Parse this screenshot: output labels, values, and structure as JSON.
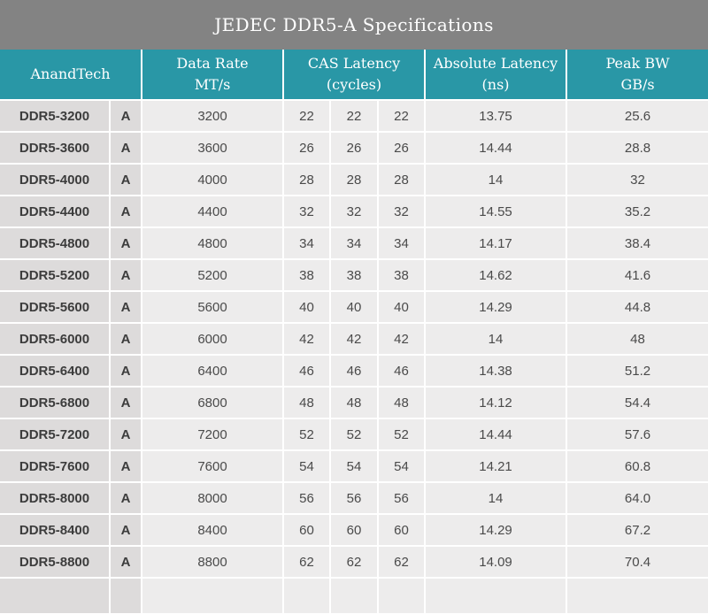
{
  "chart_data": {
    "type": "table",
    "title": "JEDEC DDR5-A Specifications",
    "column_groups": [
      {
        "label": "AnandTech",
        "sublabel": ""
      },
      {
        "label": "Data Rate",
        "sublabel": "MT/s"
      },
      {
        "label": "CAS Latency",
        "sublabel": "(cycles)"
      },
      {
        "label": "Absolute Latency",
        "sublabel": "(ns)"
      },
      {
        "label": "Peak BW",
        "sublabel": "GB/s"
      }
    ],
    "rows": [
      {
        "name": "DDR5-3200",
        "variant": "A",
        "data_rate": "3200",
        "cas": [
          "22",
          "22",
          "22"
        ],
        "absolute_latency": "13.75",
        "peak_bw": "25.6"
      },
      {
        "name": "DDR5-3600",
        "variant": "A",
        "data_rate": "3600",
        "cas": [
          "26",
          "26",
          "26"
        ],
        "absolute_latency": "14.44",
        "peak_bw": "28.8"
      },
      {
        "name": "DDR5-4000",
        "variant": "A",
        "data_rate": "4000",
        "cas": [
          "28",
          "28",
          "28"
        ],
        "absolute_latency": "14",
        "peak_bw": "32"
      },
      {
        "name": "DDR5-4400",
        "variant": "A",
        "data_rate": "4400",
        "cas": [
          "32",
          "32",
          "32"
        ],
        "absolute_latency": "14.55",
        "peak_bw": "35.2"
      },
      {
        "name": "DDR5-4800",
        "variant": "A",
        "data_rate": "4800",
        "cas": [
          "34",
          "34",
          "34"
        ],
        "absolute_latency": "14.17",
        "peak_bw": "38.4"
      },
      {
        "name": "DDR5-5200",
        "variant": "A",
        "data_rate": "5200",
        "cas": [
          "38",
          "38",
          "38"
        ],
        "absolute_latency": "14.62",
        "peak_bw": "41.6"
      },
      {
        "name": "DDR5-5600",
        "variant": "A",
        "data_rate": "5600",
        "cas": [
          "40",
          "40",
          "40"
        ],
        "absolute_latency": "14.29",
        "peak_bw": "44.8"
      },
      {
        "name": "DDR5-6000",
        "variant": "A",
        "data_rate": "6000",
        "cas": [
          "42",
          "42",
          "42"
        ],
        "absolute_latency": "14",
        "peak_bw": "48"
      },
      {
        "name": "DDR5-6400",
        "variant": "A",
        "data_rate": "6400",
        "cas": [
          "46",
          "46",
          "46"
        ],
        "absolute_latency": "14.38",
        "peak_bw": "51.2"
      },
      {
        "name": "DDR5-6800",
        "variant": "A",
        "data_rate": "6800",
        "cas": [
          "48",
          "48",
          "48"
        ],
        "absolute_latency": "14.12",
        "peak_bw": "54.4"
      },
      {
        "name": "DDR5-7200",
        "variant": "A",
        "data_rate": "7200",
        "cas": [
          "52",
          "52",
          "52"
        ],
        "absolute_latency": "14.44",
        "peak_bw": "57.6"
      },
      {
        "name": "DDR5-7600",
        "variant": "A",
        "data_rate": "7600",
        "cas": [
          "54",
          "54",
          "54"
        ],
        "absolute_latency": "14.21",
        "peak_bw": "60.8"
      },
      {
        "name": "DDR5-8000",
        "variant": "A",
        "data_rate": "8000",
        "cas": [
          "56",
          "56",
          "56"
        ],
        "absolute_latency": "14",
        "peak_bw": "64.0"
      },
      {
        "name": "DDR5-8400",
        "variant": "A",
        "data_rate": "8400",
        "cas": [
          "60",
          "60",
          "60"
        ],
        "absolute_latency": "14.29",
        "peak_bw": "67.2"
      },
      {
        "name": "DDR5-8800",
        "variant": "A",
        "data_rate": "8800",
        "cas": [
          "62",
          "62",
          "62"
        ],
        "absolute_latency": "14.09",
        "peak_bw": "70.4"
      }
    ]
  },
  "colors": {
    "title_bar_bg": "#838383",
    "header_bg": "#2997A6",
    "header_text": "#FFFFFF",
    "row_bg": "#EDECEC",
    "label_col_bg": "#DDDBDB",
    "value_text": "#4A4A4A",
    "label_text": "#3C3C3C"
  }
}
